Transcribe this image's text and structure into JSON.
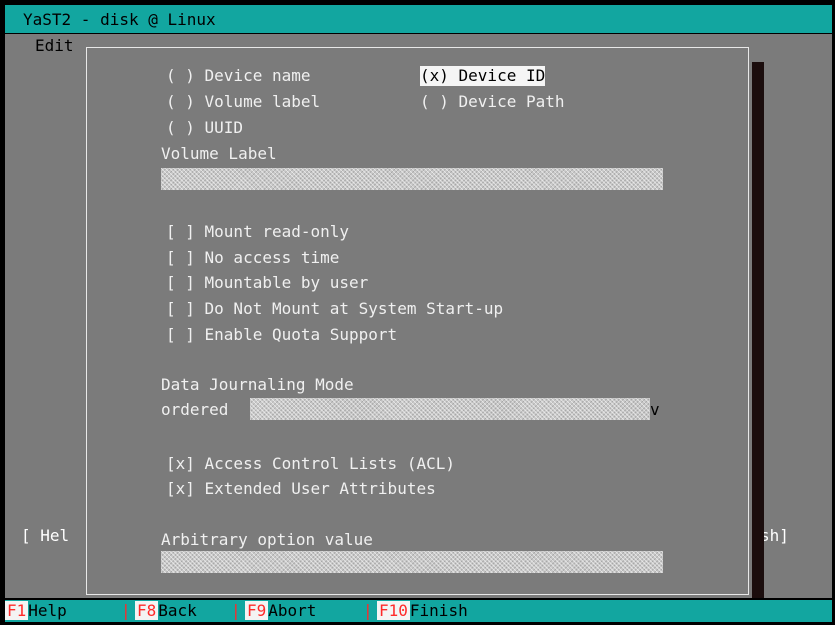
{
  "window": {
    "title": "YaST2 - disk @ Linux"
  },
  "background": {
    "edit_label": "Edit",
    "help_fragment": "[ Hel",
    "finish_fragment": "sh]"
  },
  "mount_by": {
    "device_name": "( ) Device name",
    "device_id": "(x) Device ID",
    "volume_label": "( ) Volume label",
    "device_path": "( ) Device Path",
    "uuid": "( ) UUID"
  },
  "volume_label": {
    "label": "Volume Label",
    "value": ""
  },
  "options": {
    "mount_read_only": "[ ] Mount read-only",
    "no_access_time": "[ ] No access time",
    "mountable_by_user": "[ ] Mountable by user",
    "do_not_mount": "[ ] Do Not Mount at System Start-up",
    "enable_quota": "[ ] Enable Quota Support"
  },
  "journaling": {
    "label": "Data Journaling Mode",
    "value": "ordered",
    "arrow": "v"
  },
  "acl": {
    "access_control": "[x] Access Control Lists (ACL)",
    "extended_attrs": "[x] Extended User Attributes"
  },
  "arbitrary": {
    "label": "Arbitrary option value",
    "value": ""
  },
  "fkeys": [
    {
      "key": "F1",
      "label": "Help"
    },
    {
      "key": "F8",
      "label": "Back"
    },
    {
      "key": "F9",
      "label": "Abort"
    },
    {
      "key": "F10",
      "label": "Finish"
    }
  ],
  "colors": {
    "titlebar": "#12a6a0",
    "panel": "#7b7b7b",
    "hotkey": "#000000",
    "fkey": "#ff2a2a"
  }
}
